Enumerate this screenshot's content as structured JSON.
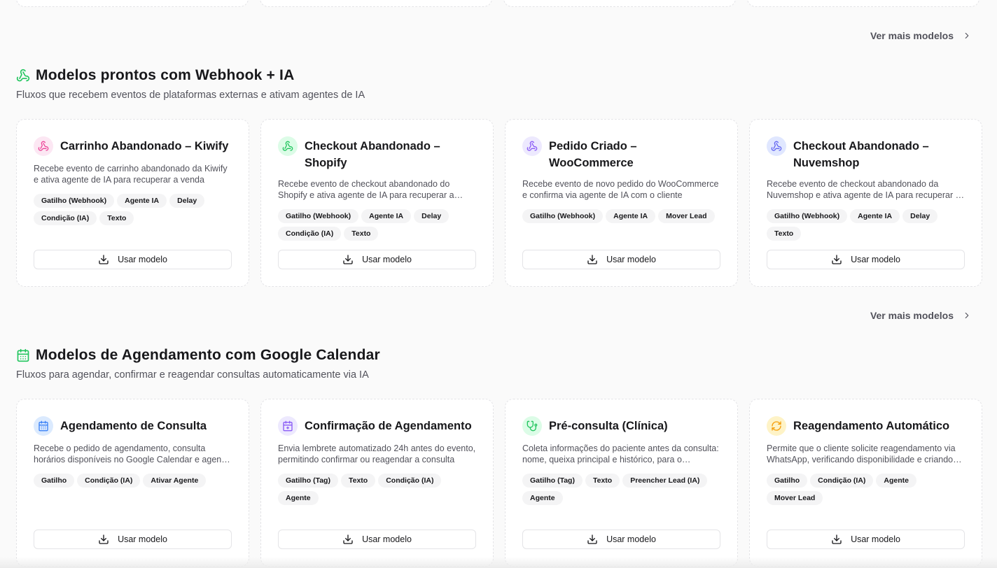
{
  "top_cards_count": 4,
  "see_more_label": "Ver mais modelos",
  "colors": {
    "green": "#22c55e",
    "pink": "#ec4899",
    "purple": "#8b5cf6",
    "blue": "#3b82f6",
    "orange": "#f59e0b"
  },
  "webhook_section": {
    "title": "Modelos prontos com Webhook + IA",
    "subtitle": "Fluxos que recebem eventos de plataformas externas e ativam agentes de IA",
    "icon": "webhook-icon",
    "cards": [
      {
        "title": "Carrinho Abandonado – Kiwify",
        "description": "Recebe evento de carrinho abandonado da Kiwify e ativa agente de IA para recuperar a venda",
        "icon": "webhook-icon",
        "icon_color": "#ec4899",
        "icon_bg": "#fce7f3",
        "tags": [
          "Gatilho (Webhook)",
          "Agente IA",
          "Delay",
          "Condição (IA)",
          "Texto"
        ],
        "button": "Usar modelo"
      },
      {
        "title": "Checkout Abandonado – Shopify",
        "description": "Recebe evento de checkout abandonado do Shopify e ativa agente de IA para recuperar a venda",
        "icon": "webhook-icon",
        "icon_color": "#22c55e",
        "icon_bg": "#dcfce7",
        "tags": [
          "Gatilho (Webhook)",
          "Agente IA",
          "Delay",
          "Condição (IA)",
          "Texto"
        ],
        "button": "Usar modelo"
      },
      {
        "title": "Pedido Criado – WooCommerce",
        "description": "Recebe evento de novo pedido do WooCommerce e confirma via agente de IA com o cliente",
        "icon": "webhook-icon",
        "icon_color": "#8b5cf6",
        "icon_bg": "#ede9fe",
        "tags": [
          "Gatilho (Webhook)",
          "Agente IA",
          "Mover Lead"
        ],
        "button": "Usar modelo"
      },
      {
        "title": "Checkout Abandonado – Nuvemshop",
        "description": "Recebe evento de checkout abandonado da Nuvemshop e ativa agente de IA para recuperar a venda",
        "icon": "webhook-icon",
        "icon_color": "#6366f1",
        "icon_bg": "#e0e7ff",
        "tags": [
          "Gatilho (Webhook)",
          "Agente IA",
          "Delay",
          "Texto"
        ],
        "button": "Usar modelo"
      }
    ]
  },
  "calendar_section": {
    "title": "Modelos de Agendamento com Google Calendar",
    "subtitle": "Fluxos para agendar, confirmar e reagendar consultas automaticamente via IA",
    "icon": "calendar-icon",
    "cards": [
      {
        "title": "Agendamento de Consulta",
        "description": "Recebe o pedido de agendamento, consulta horários disponíveis no Google Calendar e agenda automaticamente",
        "icon": "calendar-icon",
        "icon_color": "#3b82f6",
        "icon_bg": "#dbeafe",
        "tags": [
          "Gatilho",
          "Condição (IA)",
          "Ativar Agente"
        ],
        "button": "Usar modelo"
      },
      {
        "title": "Confirmação de Agendamento",
        "description": "Envia lembrete automatizado 24h antes do evento, permitindo confirmar ou reagendar a consulta",
        "icon": "calendar-check-icon",
        "icon_color": "#8b5cf6",
        "icon_bg": "#ede9fe",
        "tags": [
          "Gatilho (Tag)",
          "Texto",
          "Condição (IA)",
          "Agente"
        ],
        "button": "Usar modelo"
      },
      {
        "title": "Pré-consulta (Clínica)",
        "description": "Coleta informações do paciente antes da consulta: nome, queixa principal e histórico, para o atendimento",
        "icon": "stethoscope-icon",
        "icon_color": "#22c55e",
        "icon_bg": "#dcfce7",
        "tags": [
          "Gatilho (Tag)",
          "Texto",
          "Preencher Lead (IA)",
          "Agente"
        ],
        "button": "Usar modelo"
      },
      {
        "title": "Reagendamento Automático",
        "description": "Permite que o cliente solicite reagendamento via WhatsApp, verificando disponibilidade e criando novo horário",
        "icon": "refresh-icon",
        "icon_color": "#f59e0b",
        "icon_bg": "#fef3c7",
        "tags": [
          "Gatilho",
          "Condição (IA)",
          "Agente",
          "Mover Lead"
        ],
        "button": "Usar modelo"
      }
    ]
  }
}
